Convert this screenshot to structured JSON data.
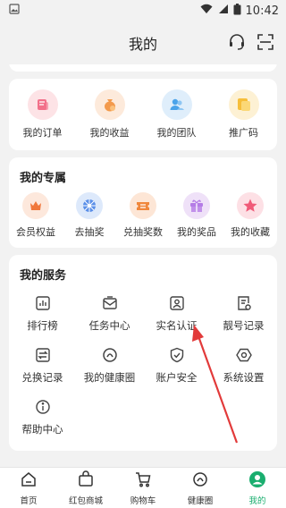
{
  "status_bar": {
    "time": "10:42"
  },
  "header": {
    "title": "我的"
  },
  "orders": [
    {
      "label": "我的订单",
      "icon": "order-icon",
      "bg": "#fde3e6",
      "fg": "#f2708a"
    },
    {
      "label": "我的收益",
      "icon": "money-bag-icon",
      "bg": "#fdeadb",
      "fg": "#f39a4c"
    },
    {
      "label": "我的团队",
      "icon": "team-icon",
      "bg": "#dfeefb",
      "fg": "#4aa3ea"
    },
    {
      "label": "推广码",
      "icon": "promo-code-icon",
      "bg": "#fdf1d4",
      "fg": "#f6be3a"
    }
  ],
  "exclusive": {
    "title": "我的专属",
    "items": [
      {
        "label": "会员权益",
        "icon": "crown-icon",
        "bg": "#fde8dc",
        "fg": "#f0783c"
      },
      {
        "label": "去抽奖",
        "icon": "lottery-wheel-icon",
        "bg": "#dde9fb",
        "fg": "#5a8fe8"
      },
      {
        "label": "兑抽奖数",
        "icon": "ticket-icon",
        "bg": "#fde6d6",
        "fg": "#f0873c"
      },
      {
        "label": "我的奖品",
        "icon": "gift-icon",
        "bg": "#efe1f8",
        "fg": "#b57ce6"
      },
      {
        "label": "我的收藏",
        "icon": "star-icon",
        "bg": "#fde0e5",
        "fg": "#f05a78"
      }
    ]
  },
  "services": {
    "title": "我的服务",
    "items": [
      {
        "label": "排行榜",
        "icon": "ranking-icon"
      },
      {
        "label": "任务中心",
        "icon": "task-mail-icon"
      },
      {
        "label": "实名认证",
        "icon": "id-verify-icon"
      },
      {
        "label": "靓号记录",
        "icon": "number-record-icon"
      },
      {
        "label": "兑换记录",
        "icon": "exchange-icon"
      },
      {
        "label": "我的健康圈",
        "icon": "health-circle-icon"
      },
      {
        "label": "账户安全",
        "icon": "shield-icon"
      },
      {
        "label": "系统设置",
        "icon": "settings-icon"
      },
      {
        "label": "帮助中心",
        "icon": "help-icon"
      }
    ]
  },
  "bottom_nav": [
    {
      "label": "首页",
      "icon": "home-icon"
    },
    {
      "label": "红包商城",
      "icon": "shop-bag-icon"
    },
    {
      "label": "购物车",
      "icon": "cart-icon"
    },
    {
      "label": "健康圈",
      "icon": "health-circle-icon"
    },
    {
      "label": "我的",
      "icon": "profile-icon",
      "active": true
    }
  ],
  "colors": {
    "accent": "#1aae6f",
    "annotation_arrow": "#e23a3a"
  }
}
